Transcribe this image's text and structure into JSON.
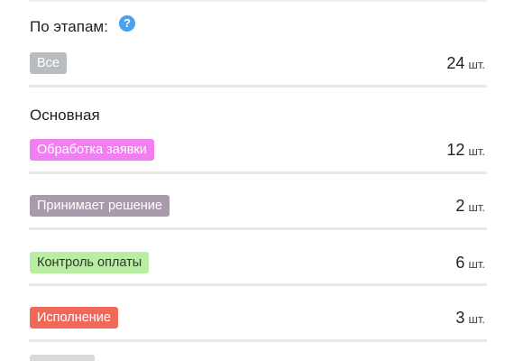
{
  "stages": {
    "title": "По этапам:",
    "help_icon": "question-circle-icon",
    "all": {
      "label": "Все",
      "count": "24",
      "unit": "шт.",
      "color": "#b9bcbe",
      "text_color": "#ffffff"
    }
  },
  "main_group": {
    "title": "Основная",
    "items": [
      {
        "label": "Обработка заявки",
        "count": "12",
        "unit": "шт.",
        "color": "#f27ef2",
        "text_color": "#ffffff"
      },
      {
        "label": "Принимает решение",
        "count": "2",
        "unit": "шт.",
        "color": "#a89aaa",
        "text_color": "#ffffff"
      },
      {
        "label": "Контроль оплаты",
        "count": "6",
        "unit": "шт.",
        "color": "#b8eda2",
        "text_color": "#2f3a2a"
      },
      {
        "label": "Исполнение",
        "count": "3",
        "unit": "шт.",
        "color": "#f0685a",
        "text_color": "#ffffff"
      }
    ]
  }
}
